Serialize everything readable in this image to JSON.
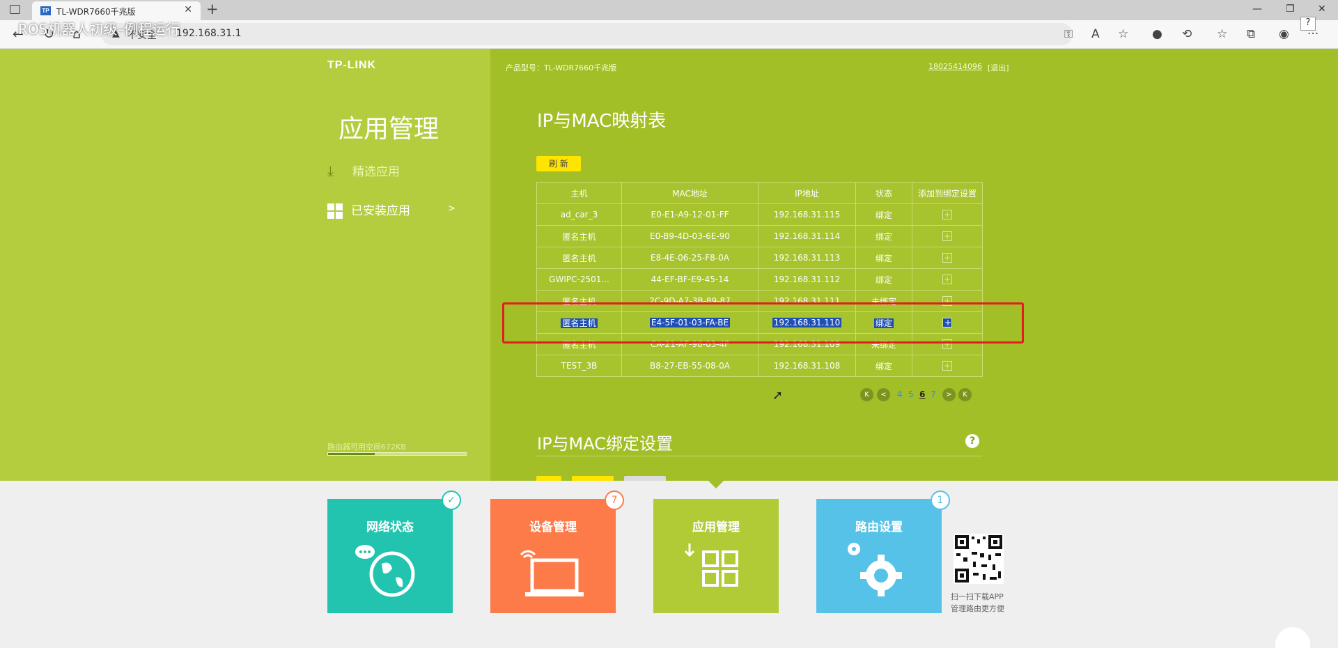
{
  "browser": {
    "tab_title": "TL-WDR7660千兆版",
    "favicon_text": "TP",
    "overlay_title": "ROS机器人初级–例程运行",
    "security_label": "不安全",
    "url": "192.168.31.1"
  },
  "router": {
    "logo": "TP-LINK",
    "model": "产品型号：TL-WDR7660千兆版",
    "account": "18025414096",
    "logout": "[退出]",
    "section_title": "应用管理",
    "menu": [
      {
        "label": "精选应用",
        "icon": "download-icon"
      },
      {
        "label": "已安装应用",
        "icon": "grid-icon",
        "arrow": ">"
      }
    ],
    "storage_label": "路由器可用空间672KB",
    "storage_fraction": 0.34,
    "map_title": "IP与MAC映射表",
    "refresh_label": "刷 新",
    "bind_title": "IP与MAC绑定设置",
    "help_symbol": "?",
    "table": {
      "headers": [
        "主机",
        "MAC地址",
        "IP地址",
        "状态",
        "添加到绑定设置"
      ],
      "rows": [
        [
          "ad_car_3",
          "E0-E1-A9-12-01-FF",
          "192.168.31.115",
          "绑定",
          "+"
        ],
        [
          "匿名主机",
          "E0-B9-4D-03-6E-90",
          "192.168.31.114",
          "绑定",
          "+"
        ],
        [
          "匿名主机",
          "E8-4E-06-25-F8-0A",
          "192.168.31.113",
          "绑定",
          "+"
        ],
        [
          "GWIPC-2501...",
          "44-EF-BF-E9-45-14",
          "192.168.31.112",
          "绑定",
          "+"
        ],
        [
          "匿名主机",
          "2C-9D-A7-3B-89-87",
          "192.168.31.111",
          "未绑定",
          "+"
        ],
        [
          "匿名主机",
          "E4-5F-01-03-FA-BE",
          "192.168.31.110",
          "绑定",
          "+"
        ],
        [
          "匿名主机",
          "CA-21-AF-96-03-4F",
          "192.168.31.109",
          "未绑定",
          "+"
        ],
        [
          "TEST_3B",
          "B8-27-EB-55-08-0A",
          "192.168.31.108",
          "绑定",
          "+"
        ]
      ],
      "selected_row": 5
    },
    "pager": {
      "first": "K",
      "prev": "<",
      "next": ">",
      "last": "K",
      "pages": [
        "4",
        "5",
        "6",
        "7"
      ],
      "current": "6"
    }
  },
  "tiles": [
    {
      "label": "网络状态",
      "color": "#22c4b0",
      "badge": "✓",
      "badge_color": "#22c4b0"
    },
    {
      "label": "设备管理",
      "color": "#fd7a49",
      "badge": "7",
      "badge_color": "#fd7a49"
    },
    {
      "label": "应用管理",
      "color": "#b0cb36",
      "badge": "",
      "badge_color": ""
    },
    {
      "label": "路由设置",
      "color": "#57c2e8",
      "badge": "1",
      "badge_color": "#57c2e8"
    }
  ],
  "qr_text": [
    "扫一扫下载APP",
    "管理路由更方便"
  ]
}
